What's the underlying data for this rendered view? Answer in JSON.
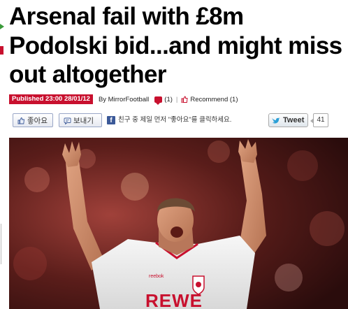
{
  "article": {
    "headline": "Arsenal fail with £8m\nPodolski bid...and might miss\nout altogether",
    "published": "Published 23:00 28/01/12",
    "byline": "By MirrorFootball",
    "comment_count": "(1)",
    "recommend": "Recommend (1)"
  },
  "social": {
    "like_label": "좋아요",
    "send_label": "보내기",
    "fb_text": "친구 중 제일 먼저 \"좋아요\"를 클릭하세요.",
    "tweet_label": "Tweet",
    "tweet_count": "41"
  },
  "photo": {
    "jersey_text": "REWE",
    "sponsor_small": "reebok"
  },
  "colors": {
    "mirror_red": "#c8102e",
    "facebook_blue": "#3b5998",
    "twitter_blue": "#2b9fd6"
  },
  "icons": [
    "thumbs-up-icon",
    "send-icon",
    "facebook-icon",
    "twitter-bird-icon",
    "comment-icon",
    "recommend-icon"
  ]
}
